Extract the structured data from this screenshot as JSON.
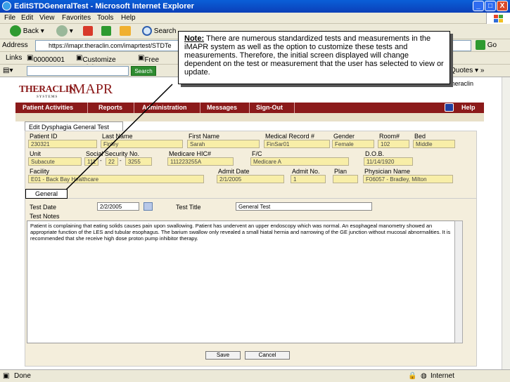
{
  "window": {
    "title": "EditSTDGeneralTest - Microsoft Internet Explorer",
    "min": "_",
    "max": "□",
    "close": "X"
  },
  "menu": [
    "File",
    "Edit",
    "View",
    "Favorites",
    "Tools",
    "Help"
  ],
  "toolbar": {
    "back": "Back",
    "search": "Search"
  },
  "address": {
    "label": "Address",
    "url": "https://imapr.theraclin.com/imaprtest/STDTe",
    "go": "Go"
  },
  "links": {
    "label": "Links",
    "item1": "00000001",
    "item2": "Customize Links",
    "item3": "Free Hot"
  },
  "google": {
    "search_label": "Search",
    "quotes": "Quotes"
  },
  "callout": {
    "heading": "Note:",
    "text": "There are numerous standardized tests and measurements in the iMAPR system as well as the option to customize these tests and measurements. Therefore, the initial screen displayed will change dependent on the test or measurement that the user has selected to view or update."
  },
  "app": {
    "logo_main": "THERACLIN",
    "logo_sub": "SYSTEMS",
    "product": "iMAPR",
    "user": "theraclin",
    "nav": [
      "Patient Activities",
      "Reports",
      "Administration",
      "Messages",
      "Sign-Out"
    ],
    "help": "Help",
    "tab": "Edit Dysphagia General Test"
  },
  "patient": {
    "labels": {
      "patient_id": "Patient ID",
      "last_name": "Last Name",
      "first_name": "First Name",
      "mrn": "Medical Record #",
      "gender": "Gender",
      "room": "Room#",
      "bed": "Bed",
      "unit": "Unit",
      "ssn": "Social Security No.",
      "medicare": "Medicare HIC#",
      "fc": "F/C",
      "dob": "D.O.B.",
      "facility": "Facility",
      "admit_date": "Admit Date",
      "admit_no": "Admit No.",
      "plan": "Plan",
      "physician": "Physician Name"
    },
    "values": {
      "patient_id": "230321",
      "last_name": "Finley",
      "first_name": "Sarah",
      "mrn": "FinSar01",
      "gender": "Female",
      "room": "102",
      "bed": "Middle",
      "unit": "Subacute",
      "ssn1": "111",
      "ssn2": "22",
      "ssn3": "3255",
      "medicare": "111223255A",
      "fc": "Medicare A",
      "dob": "11/14/1920",
      "facility": "E01 - Back Bay Healthcare",
      "admit_date": "2/1/2005",
      "admit_no": "1",
      "plan": "",
      "physician": "F06057 - Bradley, Milton"
    }
  },
  "test": {
    "tab": "General",
    "date_label": "Test Date",
    "date_value": "2/2/2005",
    "title_label": "Test Title",
    "title_value": "General Test",
    "notes_label": "Test Notes",
    "notes": "Patient is complaining that eating solids causes pain upon swallowing. Patient has undervent an upper endoscopy which was normal. An esophageal manometry showed an appropriate function of the LES and tubular esophagus. The barium swallow only revealed a small hiatal hernia and narrowing of the GE junction without mucosal abnormalities. It is recommended that she receive high dose proton pump inhibitor therapy.",
    "save": "Save",
    "cancel": "Cancel"
  },
  "status": {
    "left": "Done",
    "zone": "Internet"
  }
}
